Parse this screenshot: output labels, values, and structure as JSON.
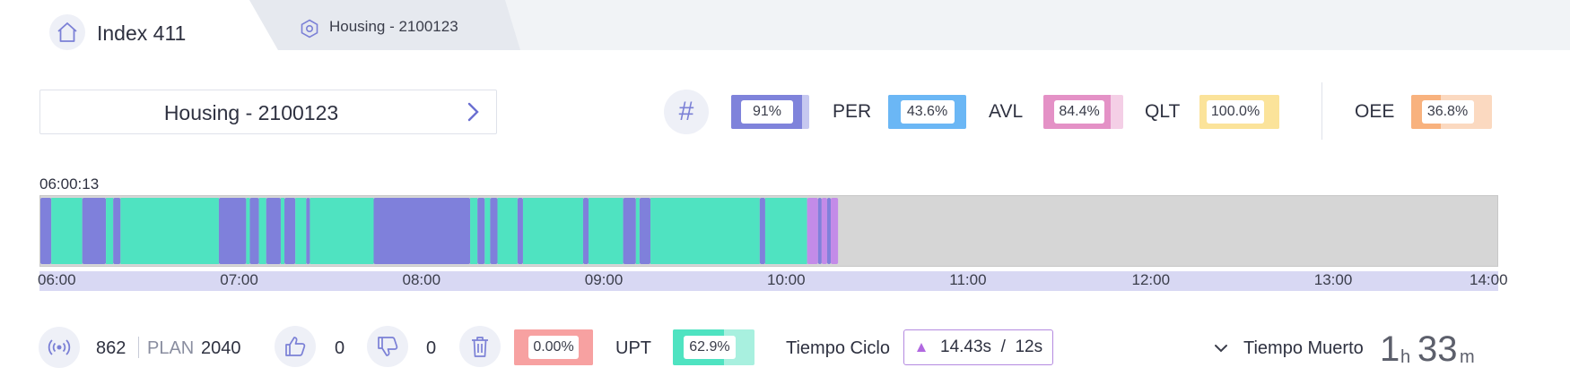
{
  "tabs": [
    {
      "label": "Index 411",
      "icon": "home-icon",
      "active": true
    },
    {
      "label": "Housing - 2100123",
      "icon": "hexagon-icon",
      "active": false
    }
  ],
  "selector": {
    "label": "Housing - 2100123"
  },
  "kpis": [
    {
      "label": "",
      "value": "91%",
      "fraction": 0.91,
      "color": "#7f83db",
      "bg": "#c6c8f0"
    },
    {
      "label": "PER",
      "value": "43.6%",
      "fraction": 0.436,
      "color": "#6bb7f5",
      "bg": "#6bb7f5"
    },
    {
      "label": "AVL",
      "value": "84.4%",
      "fraction": 0.844,
      "color": "#e491c6",
      "bg": "#f4cfe6"
    },
    {
      "label": "QLT",
      "value": "100.0%",
      "fraction": 1.0,
      "color": "#fbe39a",
      "bg": "#fbe39a"
    },
    {
      "label": "OEE",
      "value": "36.8%",
      "fraction": 0.368,
      "color": "#f8b27e",
      "bg": "#fbd9c0"
    }
  ],
  "timeline": {
    "start_time": "06:00:13",
    "ticks": [
      "06:00",
      "07:00",
      "08:00",
      "09:00",
      "10:00",
      "11:00",
      "12:00",
      "13:00",
      "14:00"
    ],
    "range_hours": [
      6,
      14
    ],
    "colors": {
      "running": "#4fe3c1",
      "stopped": "#7f80db",
      "setup": "#c38be8",
      "idle": "#d6d6d6"
    },
    "segments": [
      {
        "s": 6.0,
        "e": 6.06,
        "state": "stopped"
      },
      {
        "s": 6.06,
        "e": 6.23,
        "state": "running"
      },
      {
        "s": 6.23,
        "e": 6.36,
        "state": "stopped"
      },
      {
        "s": 6.36,
        "e": 6.4,
        "state": "running"
      },
      {
        "s": 6.4,
        "e": 6.44,
        "state": "stopped"
      },
      {
        "s": 6.44,
        "e": 6.98,
        "state": "running"
      },
      {
        "s": 6.98,
        "e": 7.13,
        "state": "stopped"
      },
      {
        "s": 7.13,
        "e": 7.15,
        "state": "running"
      },
      {
        "s": 7.15,
        "e": 7.2,
        "state": "stopped"
      },
      {
        "s": 7.2,
        "e": 7.24,
        "state": "running"
      },
      {
        "s": 7.24,
        "e": 7.32,
        "state": "stopped"
      },
      {
        "s": 7.32,
        "e": 7.34,
        "state": "running"
      },
      {
        "s": 7.34,
        "e": 7.4,
        "state": "stopped"
      },
      {
        "s": 7.4,
        "e": 7.46,
        "state": "running"
      },
      {
        "s": 7.46,
        "e": 7.48,
        "state": "stopped"
      },
      {
        "s": 7.48,
        "e": 7.83,
        "state": "running"
      },
      {
        "s": 7.83,
        "e": 8.36,
        "state": "stopped"
      },
      {
        "s": 8.36,
        "e": 8.4,
        "state": "running"
      },
      {
        "s": 8.4,
        "e": 8.44,
        "state": "stopped"
      },
      {
        "s": 8.44,
        "e": 8.47,
        "state": "running"
      },
      {
        "s": 8.47,
        "e": 8.51,
        "state": "stopped"
      },
      {
        "s": 8.51,
        "e": 8.62,
        "state": "running"
      },
      {
        "s": 8.62,
        "e": 8.65,
        "state": "stopped"
      },
      {
        "s": 8.65,
        "e": 8.98,
        "state": "running"
      },
      {
        "s": 8.98,
        "e": 9.01,
        "state": "stopped"
      },
      {
        "s": 9.01,
        "e": 9.2,
        "state": "running"
      },
      {
        "s": 9.2,
        "e": 9.27,
        "state": "stopped"
      },
      {
        "s": 9.27,
        "e": 9.29,
        "state": "running"
      },
      {
        "s": 9.29,
        "e": 9.35,
        "state": "stopped"
      },
      {
        "s": 9.35,
        "e": 9.95,
        "state": "running"
      },
      {
        "s": 9.95,
        "e": 9.98,
        "state": "stopped"
      },
      {
        "s": 9.98,
        "e": 10.21,
        "state": "running"
      },
      {
        "s": 10.21,
        "e": 10.27,
        "state": "setup"
      },
      {
        "s": 10.27,
        "e": 10.29,
        "state": "stopped"
      },
      {
        "s": 10.29,
        "e": 10.32,
        "state": "setup"
      },
      {
        "s": 10.32,
        "e": 10.34,
        "state": "stopped"
      },
      {
        "s": 10.34,
        "e": 10.38,
        "state": "setup"
      }
    ]
  },
  "stats": {
    "count": "862",
    "plan_label": "PLAN",
    "plan": "2040",
    "good": "0",
    "bad": "0",
    "scrap_value": "0.00%",
    "scrap_fraction": 0.0,
    "scrap_color": "#f7a1a1",
    "upt_label": "UPT",
    "upt_value": "62.9%",
    "upt_fraction": 0.629,
    "upt_color": "#4fe3c1",
    "upt_bg": "#a8f0df",
    "cycle_label": "Tiempo Ciclo",
    "cycle_value": "14.43s  /  12s",
    "downtime_label": "Tiempo Muerto",
    "downtime_hours": "1",
    "downtime_hours_unit": "h",
    "downtime_minutes": "33",
    "downtime_minutes_unit": "m"
  }
}
